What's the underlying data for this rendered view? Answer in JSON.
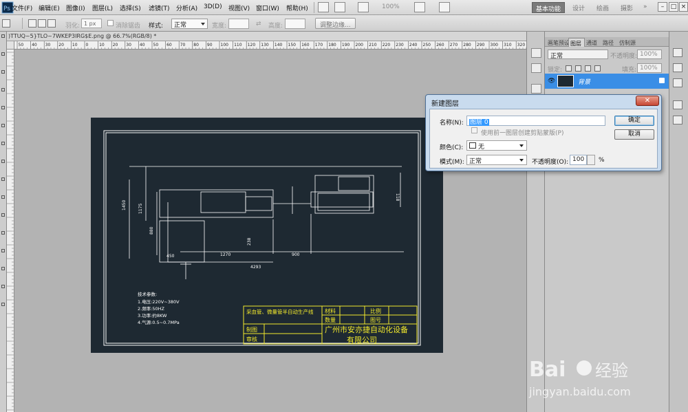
{
  "menubar": {
    "items": [
      "文件(F)",
      "编辑(E)",
      "图像(I)",
      "图层(L)",
      "选择(S)",
      "滤镜(T)",
      "分析(A)",
      "3D(D)",
      "视图(V)",
      "窗口(W)",
      "帮助(H)"
    ],
    "zoom": "100%",
    "workspaces": [
      "基本功能",
      "设计",
      "绘画",
      "摄影"
    ]
  },
  "options": {
    "feather_label": "羽化:",
    "feather_value": "1 px",
    "antialias_label": "消除锯齿",
    "style_label": "样式:",
    "style_value": "正常",
    "width_label": "宽度:",
    "height_label": "高度:",
    "refine_button": "调整边缘..."
  },
  "document": {
    "tab_title": ")TTUQ~5}TLO~7WKEP3IRG$E.png @ 66.7%(RGB/8) *",
    "ruler_h_labels": [
      "50",
      "40",
      "30",
      "20",
      "10",
      "0",
      "10",
      "20",
      "30",
      "40",
      "50",
      "60",
      "70",
      "80",
      "90",
      "100",
      "110",
      "120",
      "130",
      "140",
      "150",
      "160",
      "170",
      "180",
      "190",
      "200",
      "210",
      "220",
      "230",
      "240",
      "250",
      "260",
      "270",
      "280",
      "290",
      "300",
      "310",
      "320"
    ]
  },
  "layers_panel": {
    "tabs": [
      "画笔预设",
      "图层",
      "通道",
      "路径",
      "仿制源"
    ],
    "blend_mode": "正常",
    "opacity_label": "不透明度:",
    "opacity_value": "100%",
    "lock_label": "锁定:",
    "fill_label": "填充:",
    "fill_value": "100%",
    "layer_name": "背景"
  },
  "dialog": {
    "title": "新建图层",
    "name_label": "名称(N):",
    "name_value": "图层 0",
    "clip_label": "使用前一图层创建剪贴蒙版(P)",
    "color_label": "颜色(C):",
    "color_value": "无",
    "mode_label": "模式(M):",
    "mode_value": "正常",
    "opacity_label": "不透明度(O):",
    "opacity_value": "100",
    "percent": "%",
    "ok": "确定",
    "cancel": "取消"
  },
  "cad": {
    "dims": [
      "1450",
      "1175",
      "450",
      "880",
      "1270",
      "900",
      "4293",
      "118",
      "238"
    ],
    "notes_title": "技术参数:",
    "notes": [
      "1.电压:220V~380V",
      "2.频率:50HZ",
      "3.功率:约8KW",
      "4.气源:0.5~0.7MPa"
    ],
    "tb_title": "采血管、微量管半自动生产线",
    "tb_material": "材料",
    "tb_qty": "数量",
    "tb_scale": "比例",
    "tb_drawno": "图号",
    "tb_drawn": "制图",
    "tb_review": "审核",
    "tb_company_1": "广州市安亦捷自动化设备",
    "tb_company_2": "有限公司"
  },
  "watermark": {
    "brand": "Bai",
    "brand_cn": "经验",
    "url": "jingyan.baidu.com"
  },
  "colors": {
    "accent": "#3a8ee6",
    "cad_bg": "#1e2932",
    "cad_line": "#ffffff",
    "cad_yellow": "#f2e92c"
  }
}
